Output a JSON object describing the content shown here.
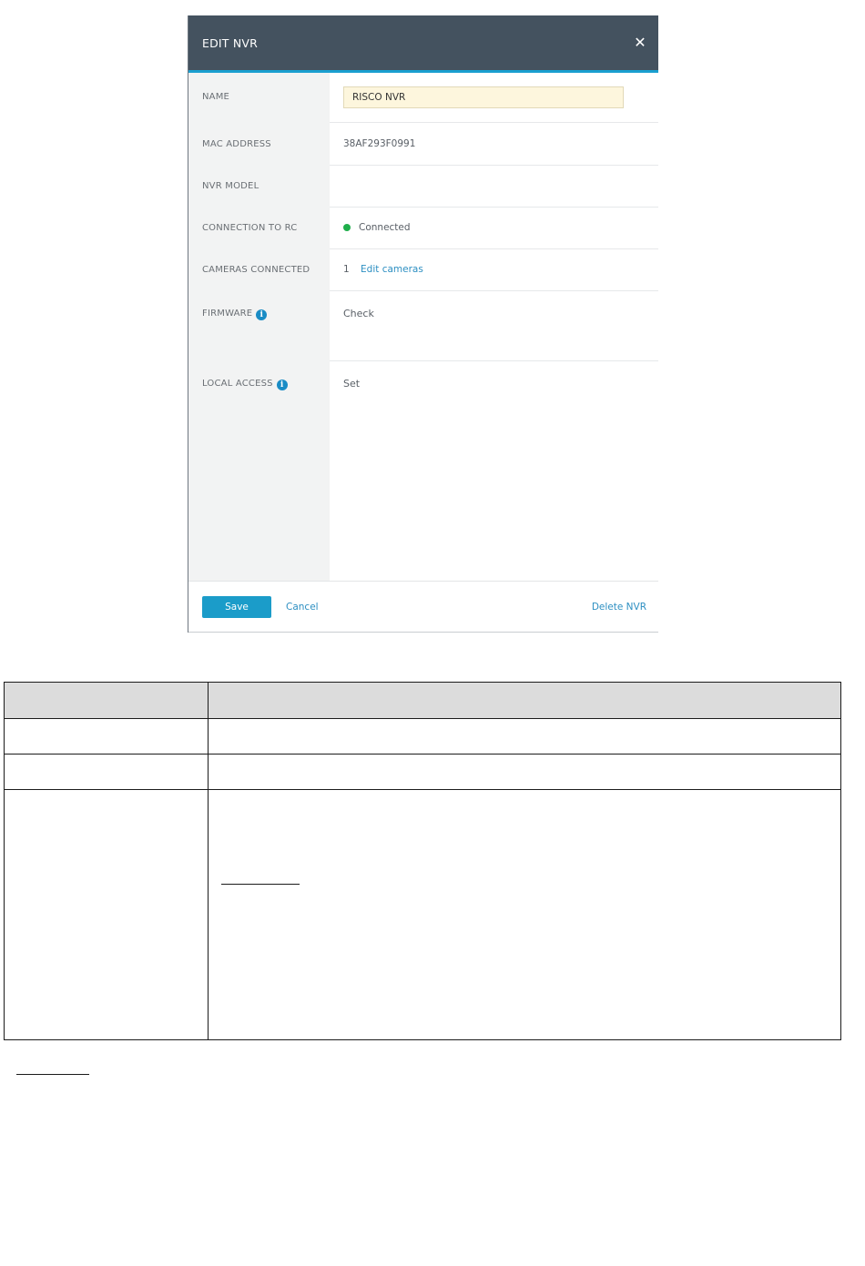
{
  "dialog": {
    "title": "EDIT NVR",
    "close_glyph": "✕",
    "fields": {
      "name": {
        "label": "NAME",
        "value": "RISCO NVR"
      },
      "mac": {
        "label": "MAC ADDRESS",
        "value": "38AF293F0991"
      },
      "model": {
        "label": "NVR MODEL",
        "value": ""
      },
      "connection": {
        "label": "CONNECTION TO RC",
        "value": "Connected",
        "status_color": "#1fae4b"
      },
      "cameras": {
        "label": "CAMERAS CONNECTED",
        "count": "1",
        "link": "Edit cameras"
      },
      "firmware": {
        "label": "FIRMWARE",
        "link": "Check"
      },
      "local_access": {
        "label": "LOCAL ACCESS",
        "link": "Set"
      }
    },
    "footer": {
      "save": "Save",
      "cancel": "Cancel",
      "delete": "Delete NVR"
    }
  },
  "colors": {
    "header_bg": "#44525f",
    "accent": "#1a9fd0",
    "link": "#2d8fc2",
    "name_field_bg": "#fdf6dd",
    "table_header_bg": "#dcdcdc"
  },
  "icons": {
    "close": "close-icon",
    "info": "info-icon",
    "status": "status-dot-icon"
  }
}
